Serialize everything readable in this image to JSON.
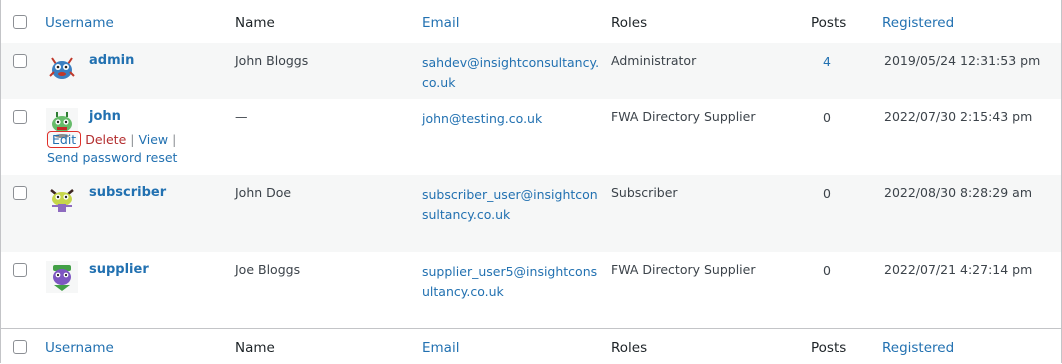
{
  "columns": {
    "username": "Username",
    "name": "Name",
    "email": "Email",
    "roles": "Roles",
    "posts": "Posts",
    "registered": "Registered"
  },
  "users": [
    {
      "username": "admin",
      "name": "John Bloggs",
      "email": "sahdev@insightconsultancy.co.uk",
      "role": "Administrator",
      "posts": "4",
      "registered": "2019/05/24 12:31:53 pm"
    },
    {
      "username": "john",
      "name": "—",
      "email": "john@testing.co.uk",
      "role": "FWA Directory Supplier",
      "posts": "0",
      "registered": "2022/07/30 2:15:43 pm"
    },
    {
      "username": "subscriber",
      "name": "John Doe",
      "email": "subscriber_user@insightconsultancy.co.uk",
      "role": "Subscriber",
      "posts": "0",
      "registered": "2022/08/30 8:28:29 am"
    },
    {
      "username": "supplier",
      "name": "Joe Bloggs",
      "email": "supplier_user5@insightconsultancy.co.uk",
      "role": "FWA Directory Supplier",
      "posts": "0",
      "registered": "2022/07/21 4:27:14 pm"
    }
  ],
  "row_actions": {
    "edit": "Edit",
    "delete": "Delete",
    "view": "View",
    "separator": "|",
    "send_reset": "Send password reset"
  },
  "colors": {
    "link": "#2271b1",
    "delete": "#b32d2e",
    "row_alt": "#f6f7f7",
    "highlight": "#e0302a"
  },
  "icons": {
    "avatar_1": "monster-avatar-red",
    "avatar_2": "monster-avatar-green",
    "avatar_3": "monster-avatar-yellow",
    "avatar_4": "monster-avatar-purple"
  }
}
